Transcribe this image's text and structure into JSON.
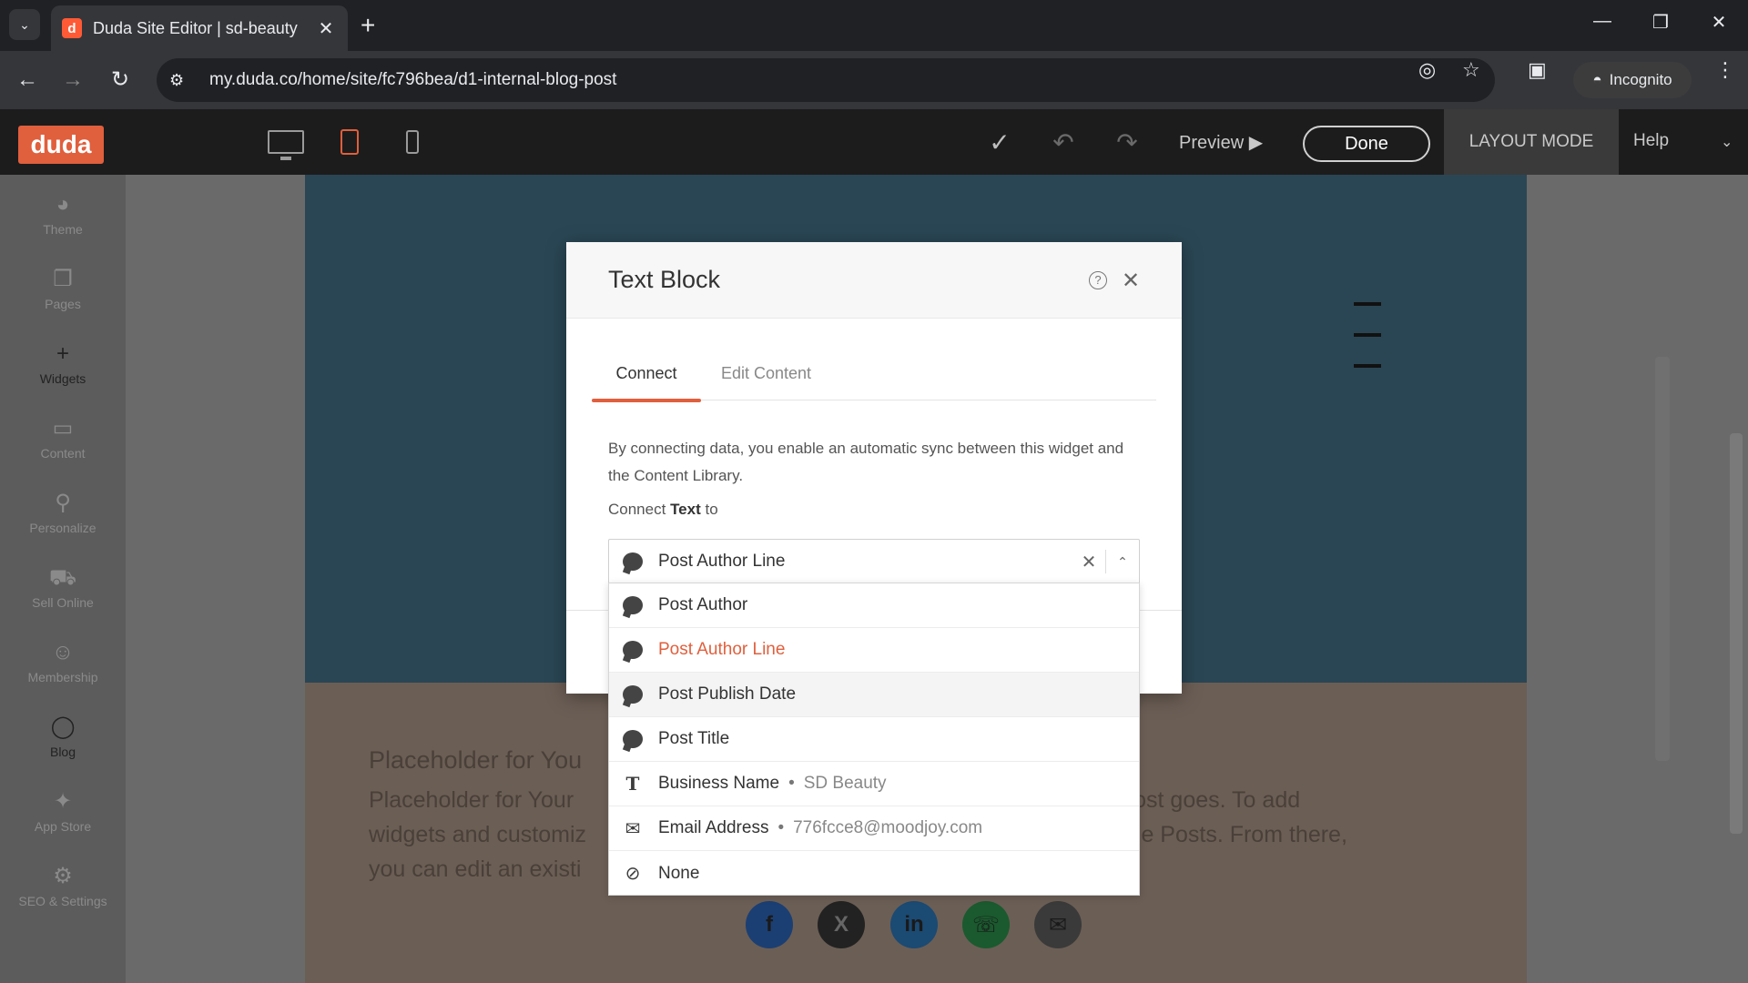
{
  "browser": {
    "tab_title": "Duda Site Editor | sd-beauty",
    "favicon_letter": "d",
    "url": "my.duda.co/home/site/fc796bea/d1-internal-blog-post",
    "incognito_label": "Incognito"
  },
  "editor": {
    "logo": "duda",
    "preview_label": "Preview",
    "done_label": "Done",
    "layout_mode_label": "LAYOUT MODE",
    "help_label": "Help"
  },
  "sidebar": {
    "items": [
      {
        "label": "Theme",
        "icon": "palette-icon"
      },
      {
        "label": "Pages",
        "icon": "pages-icon"
      },
      {
        "label": "Widgets",
        "icon": "plus-icon"
      },
      {
        "label": "Content",
        "icon": "folder-icon"
      },
      {
        "label": "Personalize",
        "icon": "wand-icon"
      },
      {
        "label": "Sell Online",
        "icon": "cart-icon"
      },
      {
        "label": "Membership",
        "icon": "user-icon"
      },
      {
        "label": "Blog",
        "icon": "chat-icon"
      },
      {
        "label": "App Store",
        "icon": "puzzle-icon"
      },
      {
        "label": "SEO & Settings",
        "icon": "gear-icon"
      }
    ]
  },
  "canvas": {
    "placeholder_title": "Placeholder for You",
    "placeholder_body_lines": [
      "Placeholder for Your",
      "widgets and customiz",
      "you can edit an existi"
    ],
    "placeholder_body_right_lines": [
      "blog post goes. To add",
      "Manage Posts. From there,"
    ]
  },
  "modal": {
    "title": "Text Block",
    "tabs": {
      "connect": "Connect",
      "edit_content": "Edit Content"
    },
    "description": "By connecting data, you enable an automatic sync between this widget and the Content Library.",
    "connect_prefix": "Connect",
    "connect_bold": "Text",
    "connect_suffix": "to",
    "selected_value": "Post Author Line"
  },
  "dropdown": {
    "items": [
      {
        "label": "Post Author",
        "icon": "chat-bubble-icon"
      },
      {
        "label": "Post Author Line",
        "icon": "chat-bubble-icon",
        "selected": true
      },
      {
        "label": "Post Publish Date",
        "icon": "chat-bubble-icon",
        "hover": true
      },
      {
        "label": "Post Title",
        "icon": "chat-bubble-icon"
      },
      {
        "label": "Business Name",
        "icon": "text-icon",
        "value": "SD Beauty"
      },
      {
        "label": "Email Address",
        "icon": "envelope-icon",
        "value": "776fcce8@moodjoy.com"
      },
      {
        "label": "None",
        "icon": "none-icon"
      }
    ]
  },
  "colors": {
    "accent": "#e05f3d"
  }
}
